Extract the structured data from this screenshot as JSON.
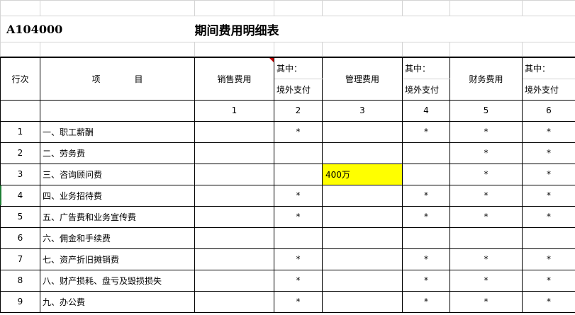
{
  "sheet": {
    "code": "A104000",
    "title": "期间费用明细表"
  },
  "header": {
    "row_no": "行次",
    "item": "项　　　　目",
    "sales": "销售费用",
    "mgmt": "管理费用",
    "finance": "财务费用",
    "of_which": "其中：",
    "overseas": "境外支付",
    "col_numbers": [
      "1",
      "2",
      "3",
      "4",
      "5",
      "6"
    ]
  },
  "rows": [
    {
      "no": "1",
      "item": "一、职工薪酬",
      "c1": "",
      "c2": "*",
      "c3": "",
      "c4": "*",
      "c5": "*",
      "c6": "*"
    },
    {
      "no": "2",
      "item": "二、劳务费",
      "c1": "",
      "c2": "",
      "c3": "",
      "c4": "",
      "c5": "*",
      "c6": "*"
    },
    {
      "no": "3",
      "item": "三、咨询顾问费",
      "c1": "",
      "c2": "",
      "c3": "400万",
      "c4": "",
      "c5": "*",
      "c6": "*"
    },
    {
      "no": "4",
      "item": "四、业务招待费",
      "c1": "",
      "c2": "*",
      "c3": "",
      "c4": "*",
      "c5": "*",
      "c6": "*"
    },
    {
      "no": "5",
      "item": "五、广告费和业务宣传费",
      "c1": "",
      "c2": "*",
      "c3": "",
      "c4": "*",
      "c5": "*",
      "c6": "*"
    },
    {
      "no": "6",
      "item": "六、佣金和手续费",
      "c1": "",
      "c2": "",
      "c3": "",
      "c4": "",
      "c5": "",
      "c6": ""
    },
    {
      "no": "7",
      "item": "七、资产折旧摊销费",
      "c1": "",
      "c2": "*",
      "c3": "",
      "c4": "*",
      "c5": "*",
      "c6": "*"
    },
    {
      "no": "8",
      "item": "八、财产损耗、盘亏及毁损损失",
      "c1": "",
      "c2": "*",
      "c3": "",
      "c4": "*",
      "c5": "*",
      "c6": "*"
    },
    {
      "no": "9",
      "item": "九、办公费",
      "c1": "",
      "c2": "*",
      "c3": "",
      "c4": "*",
      "c5": "*",
      "c6": "*"
    }
  ],
  "colors": {
    "highlight": "#ffff00",
    "comment_marker": "#c00000",
    "gridline": "#d4d4d4"
  }
}
